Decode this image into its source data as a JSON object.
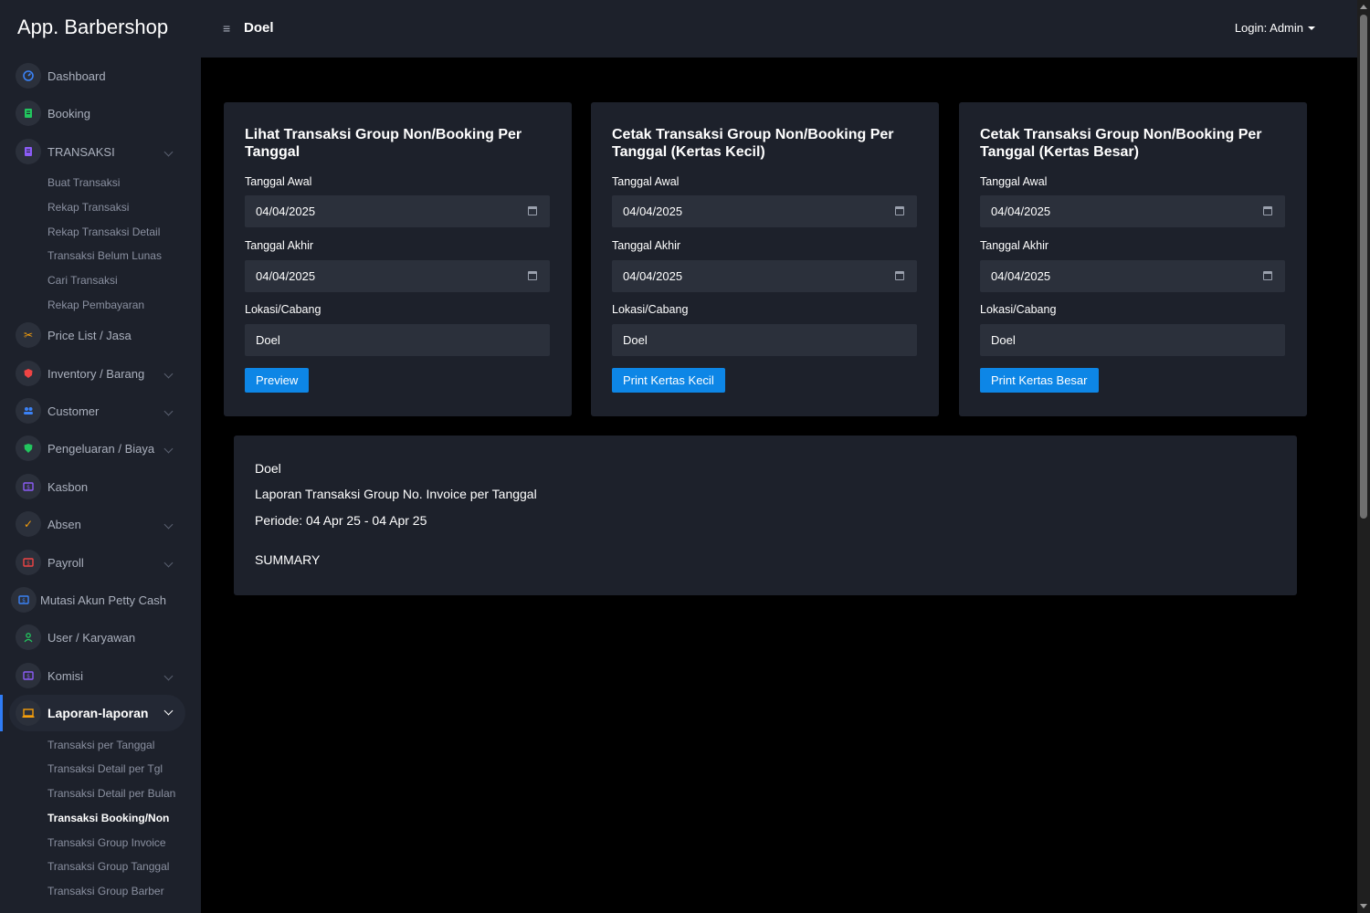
{
  "header": {
    "app_title": "App. Barbershop",
    "menu_icon": "hamburger-icon",
    "page_title": "Doel",
    "login_label": "Login: Admin"
  },
  "sidebar": {
    "items": [
      {
        "label": "Dashboard",
        "icon": "dashboard-icon",
        "icon_color": "#3b82f6"
      },
      {
        "label": "Booking",
        "icon": "booking-icon",
        "icon_color": "#22c55e"
      },
      {
        "label": "TRANSAKSI",
        "icon": "transaction-icon",
        "icon_color": "#8b5cf6"
      },
      {
        "label": "Price List / Jasa",
        "icon": "scissors-icon",
        "icon_color": "#f59e0b"
      },
      {
        "label": "Inventory / Barang",
        "icon": "inventory-icon",
        "icon_color": "#ef4444"
      },
      {
        "label": "Customer",
        "icon": "customer-icon",
        "icon_color": "#3b82f6"
      },
      {
        "label": "Pengeluaran / Biaya",
        "icon": "shield-icon",
        "icon_color": "#22c55e"
      },
      {
        "label": "Kasbon",
        "icon": "kasbon-icon",
        "icon_color": "#8b5cf6"
      },
      {
        "label": "Absen",
        "icon": "check-icon",
        "icon_color": "#f59e0b"
      },
      {
        "label": "Payroll",
        "icon": "payroll-icon",
        "icon_color": "#ef4444"
      },
      {
        "label": "Mutasi Akun Petty Cash",
        "icon": "petty-cash-icon",
        "icon_color": "#3b82f6"
      },
      {
        "label": "User / Karyawan",
        "icon": "user-icon",
        "icon_color": "#22c55e"
      },
      {
        "label": "Komisi",
        "icon": "komisi-icon",
        "icon_color": "#8b5cf6"
      },
      {
        "label": "Laporan-laporan",
        "icon": "laptop-icon",
        "icon_color": "#f59e0b"
      }
    ],
    "transaksi_sub": [
      "Buat Transaksi",
      "Rekap Transaksi",
      "Rekap Transaksi Detail",
      "Transaksi Belum Lunas",
      "Cari Transaksi",
      "Rekap Pembayaran"
    ],
    "laporan_sub": [
      "Transaksi per Tanggal",
      "Transaksi Detail per Tgl",
      "Transaksi Detail per Bulan",
      "Transaksi Booking/Non",
      "Transaksi Group Invoice",
      "Transaksi Group Tanggal",
      "Transaksi Group Barber"
    ]
  },
  "cards": [
    {
      "title": "Lihat Transaksi Group Non/Booking Per Tanggal",
      "start_label": "Tanggal Awal",
      "start_value": "04/04/2025",
      "end_label": "Tanggal Akhir",
      "end_value": "04/04/2025",
      "location_label": "Lokasi/Cabang",
      "location_value": "Doel",
      "button_label": "Preview"
    },
    {
      "title": "Cetak Transaksi Group Non/Booking Per Tanggal (Kertas Kecil)",
      "start_label": "Tanggal Awal",
      "start_value": "04/04/2025",
      "end_label": "Tanggal Akhir",
      "end_value": "04/04/2025",
      "location_label": "Lokasi/Cabang",
      "location_value": "Doel",
      "button_label": "Print Kertas Kecil"
    },
    {
      "title": "Cetak Transaksi Group Non/Booking Per Tanggal (Kertas Besar)",
      "start_label": "Tanggal Awal",
      "start_value": "04/04/2025",
      "end_label": "Tanggal Akhir",
      "end_value": "04/04/2025",
      "location_label": "Lokasi/Cabang",
      "location_value": "Doel",
      "button_label": "Print Kertas Besar"
    }
  ],
  "report": {
    "location": "Doel",
    "title": "Laporan Transaksi Group No. Invoice per Tanggal",
    "period": "Periode: 04 Apr 25 - 04 Apr 25",
    "summary": "SUMMARY"
  },
  "colors": {
    "panel_bg": "#1d212b",
    "input_bg": "#2b303b",
    "button": "#0d86e6",
    "active_accent": "#2f7cf6"
  }
}
